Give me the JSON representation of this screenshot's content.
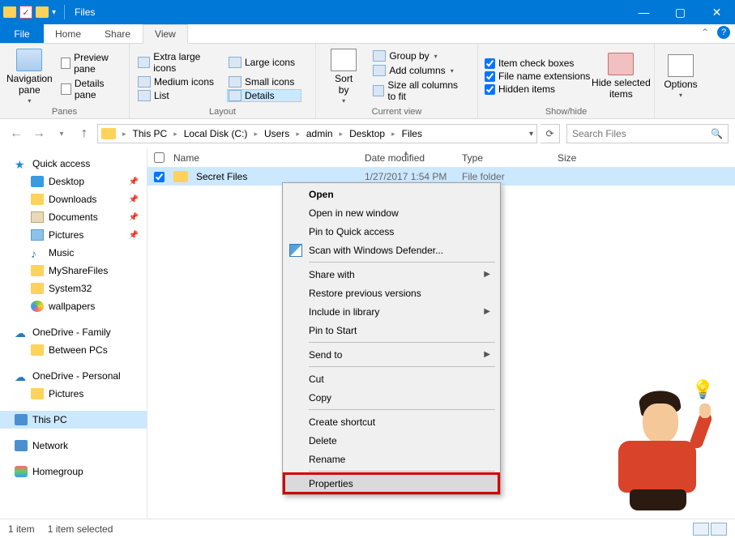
{
  "window": {
    "title": "Files"
  },
  "qat": {
    "caret": "▾"
  },
  "tabs": {
    "file": "File",
    "home": "Home",
    "share": "Share",
    "view": "View",
    "caret": "⌃"
  },
  "ribbon": {
    "panes": {
      "navigation": "Navigation\npane",
      "preview": "Preview pane",
      "details": "Details pane",
      "group": "Panes",
      "caret": "▾"
    },
    "layout": {
      "xlarge": "Extra large icons",
      "large": "Large icons",
      "medium": "Medium icons",
      "small": "Small icons",
      "list": "List",
      "details": "Details",
      "group": "Layout"
    },
    "current": {
      "sort": "Sort\nby",
      "groupby": "Group by",
      "addcols": "Add columns",
      "sizeall": "Size all columns to fit",
      "group": "Current view",
      "caret": "▾"
    },
    "showhide": {
      "itemcheck": "Item check boxes",
      "ext": "File name extensions",
      "hidden": "Hidden items",
      "hidesel": "Hide selected\nitems",
      "group": "Show/hide"
    },
    "options": {
      "label": "Options",
      "caret": "▾"
    }
  },
  "nav": {
    "back": "←",
    "fwd": "→",
    "down": "▾",
    "up": "↑",
    "refresh": "⟳",
    "search_placeholder": "Search Files",
    "search_icon": "🔍",
    "crumbs": [
      "This PC",
      "Local Disk (C:)",
      "Users",
      "admin",
      "Desktop",
      "Files"
    ],
    "crumb_end_caret": "▾"
  },
  "cols": {
    "name": "Name",
    "date": "Date modified",
    "type": "Type",
    "size": "Size",
    "sort_arrow": "▲"
  },
  "rows": [
    {
      "name": "Secret Files",
      "date": "1/27/2017 1:54 PM",
      "type": "File folder",
      "size": "",
      "checked": true
    }
  ],
  "sidebar": {
    "quick": "Quick access",
    "quick_items": [
      {
        "label": "Desktop",
        "icon": "ic-desktop",
        "pin": true
      },
      {
        "label": "Downloads",
        "icon": "ic-folder",
        "pin": true
      },
      {
        "label": "Documents",
        "icon": "ic-doc",
        "pin": true
      },
      {
        "label": "Pictures",
        "icon": "ic-pic",
        "pin": true
      },
      {
        "label": "Music",
        "icon": "ic-music",
        "pin": false,
        "glyph": "♪"
      },
      {
        "label": "MyShareFiles",
        "icon": "ic-folder",
        "pin": false
      },
      {
        "label": "System32",
        "icon": "ic-folder",
        "pin": false
      },
      {
        "label": "wallpapers",
        "icon": "ic-cd",
        "pin": false
      }
    ],
    "od_family": "OneDrive - Family",
    "od_family_items": [
      {
        "label": "Between PCs",
        "icon": "ic-folder"
      }
    ],
    "od_personal": "OneDrive - Personal",
    "od_personal_items": [
      {
        "label": "Pictures",
        "icon": "ic-folder"
      }
    ],
    "thispc": "This PC",
    "network": "Network",
    "homegroup": "Homegroup"
  },
  "ctx": {
    "open": "Open",
    "open_new": "Open in new window",
    "pin_qa": "Pin to Quick access",
    "defender": "Scan with Windows Defender...",
    "share": "Share with",
    "restore": "Restore previous versions",
    "include": "Include in library",
    "pin_start": "Pin to Start",
    "sendto": "Send to",
    "cut": "Cut",
    "copy": "Copy",
    "shortcut": "Create shortcut",
    "delete": "Delete",
    "rename": "Rename",
    "props": "Properties"
  },
  "status": {
    "count": "1 item",
    "selected": "1 item selected"
  }
}
